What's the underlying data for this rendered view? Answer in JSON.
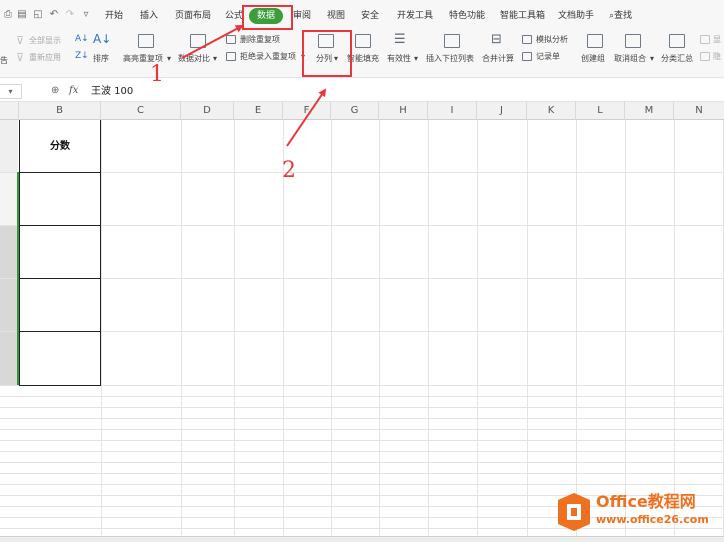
{
  "menu": {
    "tabs": [
      {
        "label": "开始"
      },
      {
        "label": "插入"
      },
      {
        "label": "页面布局"
      },
      {
        "label": "公式"
      },
      {
        "label": "数据"
      },
      {
        "label": "审阅"
      },
      {
        "label": "视图"
      },
      {
        "label": "安全"
      },
      {
        "label": "开发工具"
      },
      {
        "label": "特色功能"
      },
      {
        "label": "智能工具箱"
      },
      {
        "label": "文档助手"
      }
    ],
    "search_label": "查找",
    "active_tab": "数据",
    "active_color": "#3c9d3a"
  },
  "ribbon": {
    "show_all": "全部显示",
    "reapply": "重新应用",
    "sort": "排序",
    "highlight_dup": "高亮重复项",
    "data_compare": "数据对比",
    "remove_dup": "删除重复项",
    "reject_dup": "拒绝录入重复项",
    "split_column": "分列",
    "smart_fill": "智能填充",
    "validity": "有效性",
    "insert_dropdown": "插入下拉列表",
    "consolidate": "合并计算",
    "what_if": "模拟分析",
    "record_form": "记录单",
    "create_group": "创建组",
    "ungroup": "取消组合",
    "subtotal": "分类汇总",
    "partial_left": "告",
    "partial_right_a": "显",
    "partial_right_b": "隐"
  },
  "formula_bar": {
    "name_box": "",
    "fx_symbol": "fx",
    "content": "王波 100"
  },
  "sheet": {
    "columns": [
      "B",
      "C",
      "D",
      "E",
      "F",
      "G",
      "H",
      "I",
      "J",
      "K",
      "L",
      "M",
      "N"
    ],
    "header_cell": "分数"
  },
  "annotations": {
    "step1": "1",
    "step2": "2",
    "color": "#e8373b"
  },
  "watermark": {
    "brand": "Office教程网",
    "url": "www.office26.com",
    "color": "#f07021"
  }
}
